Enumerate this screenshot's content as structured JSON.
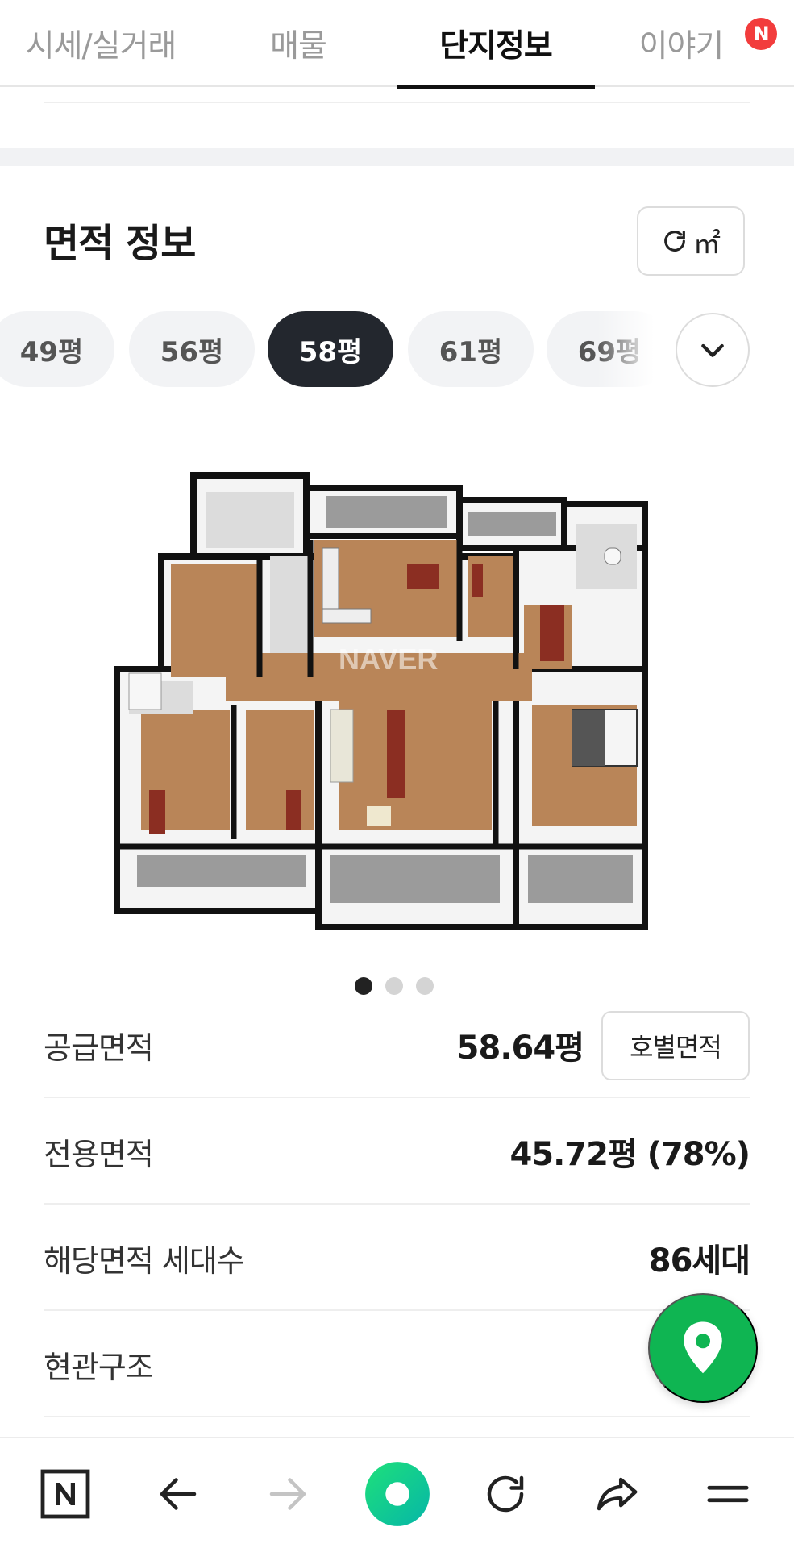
{
  "tabs": [
    {
      "label": "시세/실거래"
    },
    {
      "label": "매물"
    },
    {
      "label": "단지정보",
      "active": true
    },
    {
      "label": "이야기",
      "badge": "N"
    }
  ],
  "area_section": {
    "title": "면적 정보",
    "unit_toggle_label": "㎡"
  },
  "area_chips": [
    {
      "label": "49평"
    },
    {
      "label": "56평"
    },
    {
      "label": "58평",
      "active": true
    },
    {
      "label": "61평"
    },
    {
      "label": "69평"
    }
  ],
  "floor_plan": {
    "watermark": "NAVER",
    "image_count": 3,
    "current_image": 1
  },
  "info_rows": [
    {
      "label": "공급면적",
      "value": "58.64평",
      "button": "호별면적"
    },
    {
      "label": "전용면적",
      "value": "45.72평 (78%)"
    },
    {
      "label": "해당면적 세대수",
      "value": "86세대"
    },
    {
      "label": "현관구조",
      "value": ""
    }
  ],
  "colors": {
    "accent_green": "#0fb552",
    "badge_red": "#f23c3c",
    "chip_active": "#23272e"
  },
  "bottom_nav": {
    "icons": [
      "naver-n-icon",
      "back-arrow-icon",
      "forward-arrow-icon",
      "home-green-icon",
      "refresh-icon",
      "share-icon",
      "menu-icon"
    ]
  }
}
